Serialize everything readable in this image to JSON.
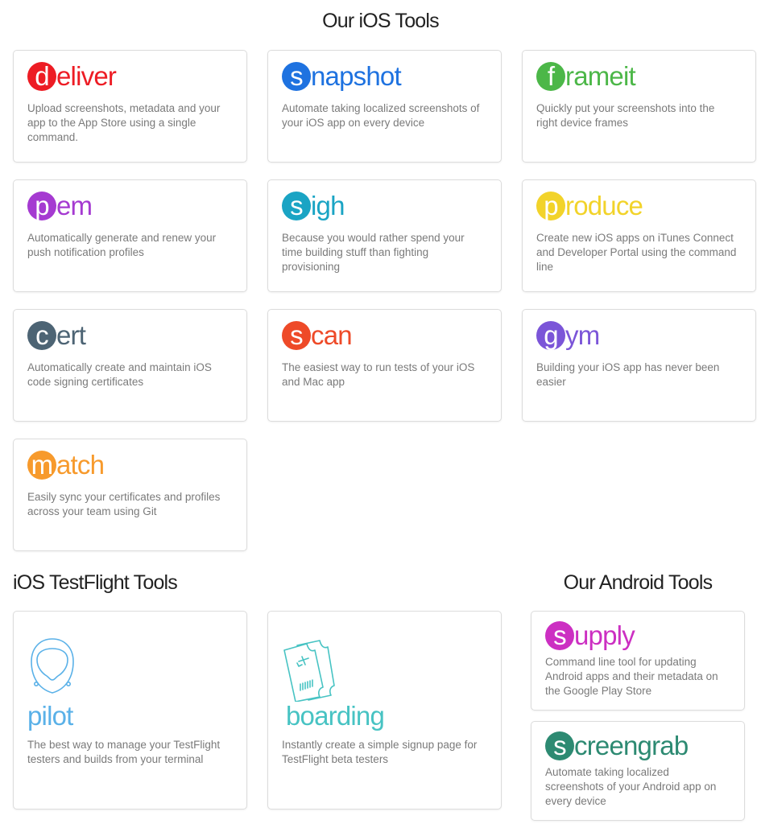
{
  "sections": {
    "ios_title": "Our iOS Tools",
    "testflight_title": "iOS TestFlight Tools",
    "android_title": "Our Android Tools"
  },
  "ios_tools": [
    {
      "initial": "d",
      "rest": "eliver",
      "color": "#ed1c24",
      "desc": "Upload screenshots, metadata and your app to the App Store using a single command."
    },
    {
      "initial": "s",
      "rest": "napshot",
      "color": "#1e72e0",
      "desc": "Automate taking localized screenshots of your iOS app on every device"
    },
    {
      "initial": "f",
      "rest": "rameit",
      "color": "#4cb748",
      "desc": "Quickly put your screenshots into the right device frames"
    },
    {
      "initial": "p",
      "rest": "em",
      "color": "#a53ad1",
      "desc": "Automatically generate and renew your push notification profiles"
    },
    {
      "initial": "s",
      "rest": "igh",
      "color": "#1aa4c4",
      "desc": "Because you would rather spend your time building stuff than fighting provisioning"
    },
    {
      "initial": "p",
      "rest": "roduce",
      "color": "#f2d32a",
      "desc": "Create new iOS apps on iTunes Connect and Developer Portal using the command line"
    },
    {
      "initial": "c",
      "rest": "ert",
      "color": "#4d6474",
      "desc": "Automatically create and maintain iOS code signing certificates"
    },
    {
      "initial": "s",
      "rest": "can",
      "color": "#ee4a28",
      "desc": "The easiest way to run tests of your iOS and Mac app"
    },
    {
      "initial": "g",
      "rest": "ym",
      "color": "#7b55d8",
      "desc": "Building your iOS app has never been easier"
    },
    {
      "initial": "m",
      "rest": "atch",
      "color": "#f79a2c",
      "desc": "Easily sync your certificates and profiles across your team using Git"
    }
  ],
  "testflight_tools": [
    {
      "name": "pilot",
      "color": "#5ab1e8",
      "icon": "pilot-helmet-icon",
      "desc": "The best way to manage your TestFlight testers and builds from your terminal"
    },
    {
      "name": "boarding",
      "color": "#47c3c3",
      "icon": "boarding-pass-icon",
      "desc": "Instantly create a simple signup page for TestFlight beta testers"
    }
  ],
  "android_tools": [
    {
      "initial": "s",
      "rest": "upply",
      "color": "#cc2fc2",
      "desc": "Command line tool for updating Android apps and their metadata on the Google Play Store"
    },
    {
      "initial": "s",
      "rest": "creengrab",
      "color": "#2d8a72",
      "desc": "Automate taking localized screenshots of your Android app on every device"
    }
  ]
}
